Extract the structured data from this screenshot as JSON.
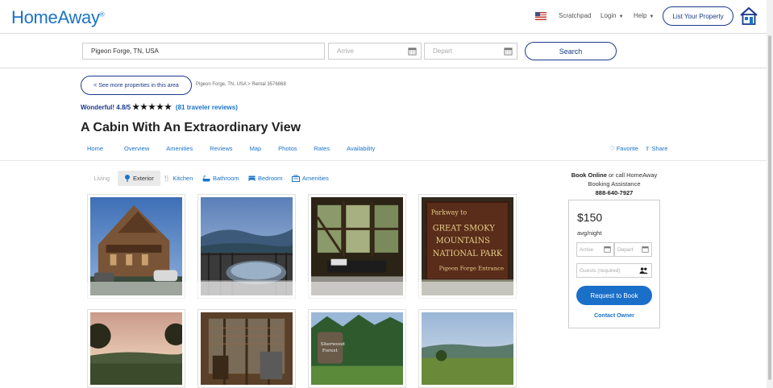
{
  "header": {
    "logo": "HomeAway",
    "logo_mark": "®",
    "nav": {
      "flag_icon": "us-flag-icon",
      "scratchpad": "Scratchpad",
      "login": "Login",
      "help": "Help",
      "list_property": "List Your Property",
      "house_icon": "homeaway-house-icon"
    }
  },
  "search": {
    "location_value": "Pigeon Forge, TN, USA",
    "arrive_placeholder": "Arrive",
    "depart_placeholder": "Depart",
    "button": "Search",
    "calendar_icon": "calendar-icon"
  },
  "listing": {
    "back_link": "< See more properties in this area",
    "breadcrumb": "Pigeon Forge, TN, USA > Rental 3576868",
    "rating_text": "Wonderful! 4.8/5",
    "stars": "★★★★★",
    "reviews_link": "(81 traveler reviews)",
    "title": "A Cabin With An Extraordinary View",
    "tabs": [
      "Home",
      "Overview",
      "Amenities",
      "Reviews",
      "Map",
      "Photos",
      "Rates",
      "Availability"
    ],
    "favorite": "Favorite",
    "share": "Share"
  },
  "photo_categories": [
    {
      "label": "Living",
      "icon": "living-icon"
    },
    {
      "label": "Exterior",
      "icon": "tree-icon"
    },
    {
      "label": "Kitchen",
      "icon": "utensils-icon"
    },
    {
      "label": "Bathroom",
      "icon": "bathtub-icon"
    },
    {
      "label": "Bedroom",
      "icon": "bed-icon"
    },
    {
      "label": "Amenities",
      "icon": "amenities-icon"
    }
  ],
  "booking": {
    "line1_bold": "Book Online",
    "line1_rest": " or call HomeAway",
    "line2": "Booking Assistance",
    "phone": "888-640-7927",
    "price": "$150",
    "per": "avg/night",
    "arrive_placeholder": "Arrive",
    "depart_placeholder": "Depart",
    "guests_placeholder": "Guests (required)",
    "request_button": "Request to Book",
    "contact_owner": "Contact Owner"
  },
  "colors": {
    "brand_blue": "#1a73c8",
    "dark_blue": "#1a3a8a",
    "button_blue": "#1a6fc9"
  }
}
